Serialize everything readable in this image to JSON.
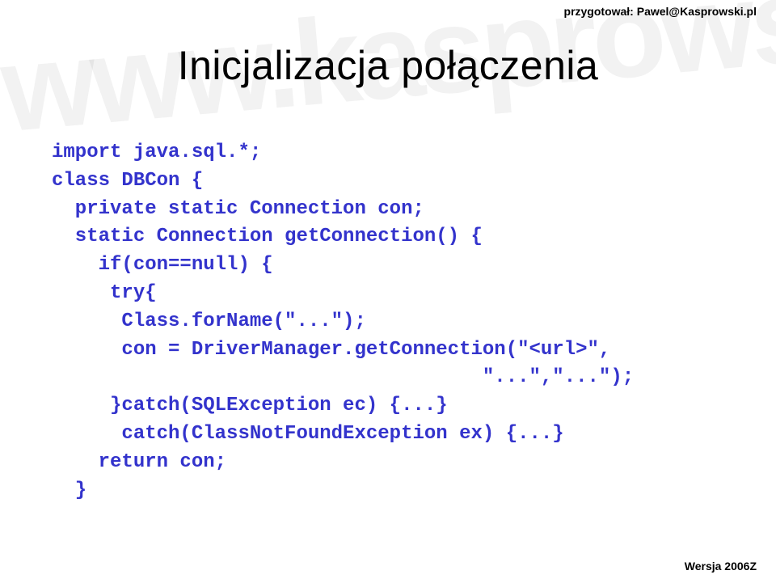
{
  "header": "przygotował: Pawel@Kasprowski.pl",
  "title": "Inicjalizacja połączenia",
  "code_lines": [
    "import java.sql.*;",
    "class DBCon {",
    "  private static Connection con;",
    "  static Connection getConnection() {",
    "    if(con==null) {",
    "     try{",
    "      Class.forName(\"...\");",
    "      con = DriverManager.getConnection(\"<url>\",",
    "                                     \"...\",\"...\");",
    "     }catch(SQLException ec) {...}",
    "      catch(ClassNotFoundException ex) {...}",
    "    return con;",
    "  }"
  ],
  "footer": "Wersja 2006Z",
  "watermark": "www.kasprowski.pl"
}
